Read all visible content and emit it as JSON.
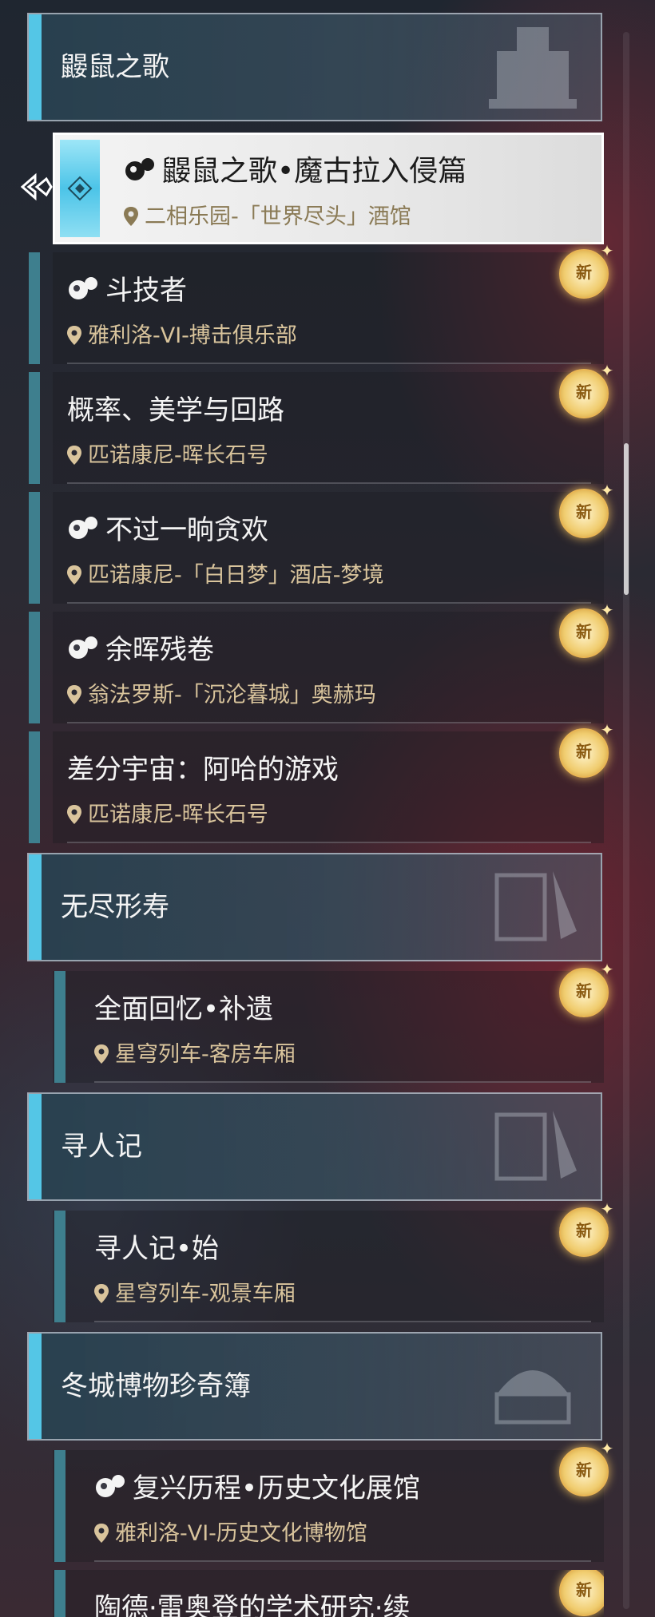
{
  "groups": [
    {
      "title": "鼹鼠之歌",
      "quests": [
        {
          "name": "鼹鼠之歌•魔古拉入侵篇",
          "location": "二相乐园-「世界尽头」酒馆",
          "has_icon": true,
          "selected": true,
          "is_new": false
        },
        {
          "name": "斗技者",
          "location": "雅利洛-VI-搏击俱乐部",
          "has_icon": true,
          "is_new": true
        },
        {
          "name": "概率、美学与回路",
          "location": "匹诺康尼-晖长石号",
          "has_icon": false,
          "is_new": true
        },
        {
          "name": "不过一晌贪欢",
          "location": "匹诺康尼-「白日梦」酒店-梦境",
          "has_icon": true,
          "is_new": true
        },
        {
          "name": "余晖残卷",
          "location": "翁法罗斯-「沉沦暮城」奥赫玛",
          "has_icon": true,
          "is_new": true
        },
        {
          "name": "差分宇宙：阿哈的游戏",
          "location": "匹诺康尼-晖长石号",
          "has_icon": false,
          "is_new": true
        }
      ]
    },
    {
      "title": "无尽形寿",
      "quests": [
        {
          "name": "全面回忆•补遗",
          "location": "星穹列车-客房车厢",
          "has_icon": false,
          "is_new": true
        }
      ]
    },
    {
      "title": "寻人记",
      "quests": [
        {
          "name": "寻人记•始",
          "location": "星穹列车-观景车厢",
          "has_icon": false,
          "is_new": true
        }
      ]
    },
    {
      "title": "冬城博物珍奇簿",
      "quests": [
        {
          "name": "复兴历程•历史文化展馆",
          "location": "雅利洛-VI-历史文化博物馆",
          "has_icon": true,
          "is_new": true
        },
        {
          "name": "陶德·雷奥登的学术研究·续",
          "location": "",
          "has_icon": false,
          "is_new": true
        }
      ]
    }
  ],
  "new_badge_label": "新",
  "icons": {
    "location": "map-pin-icon",
    "quest": "mole-quest-icon",
    "selected": "selection-arrow-icon"
  },
  "colors": {
    "accent": "#54c6e6",
    "location_text": "#d9c49c",
    "badge": "#f0cc6e"
  }
}
